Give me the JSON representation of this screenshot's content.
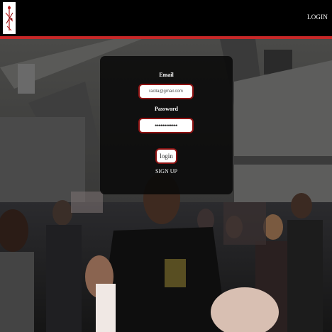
{
  "header": {
    "login_link": "LOGIN"
  },
  "login_form": {
    "email_label": "Email",
    "email_value": "raclla@gmail.com",
    "password_label": "Password",
    "password_value": "••••••••••••",
    "login_button": "login",
    "signup_link": "SIGN UP"
  },
  "colors": {
    "accent": "#c62828",
    "input_border": "#8e1212",
    "header_bg": "#000000"
  },
  "icons": {
    "logo": "dancer-logo"
  }
}
